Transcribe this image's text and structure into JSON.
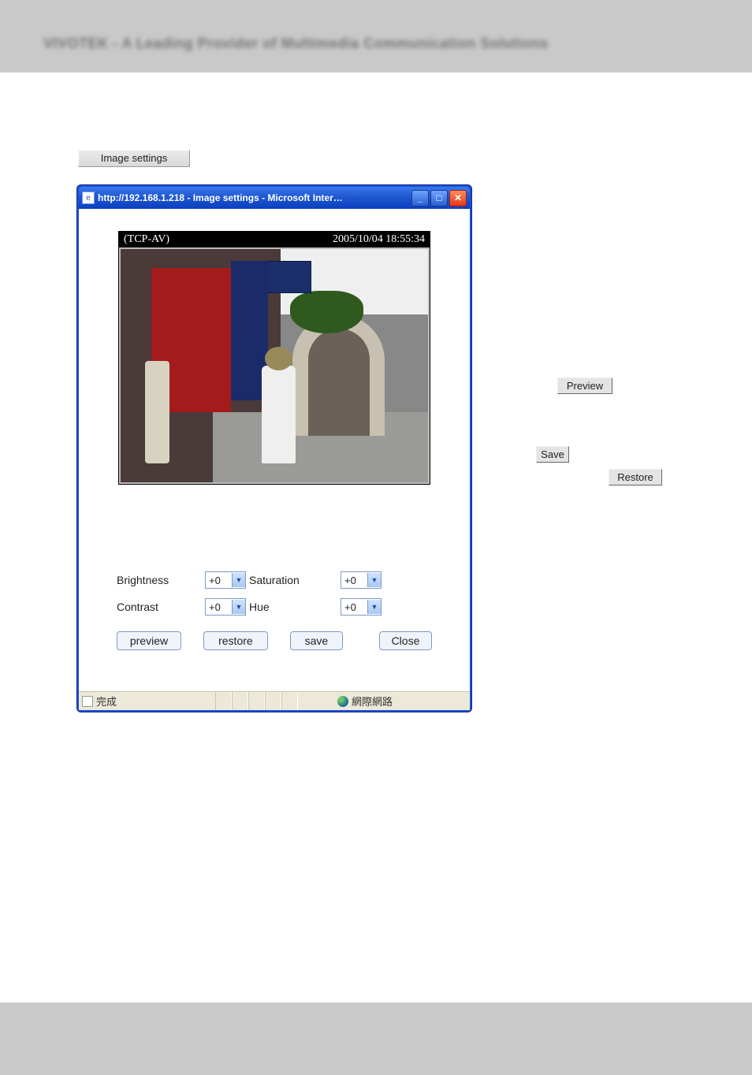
{
  "header": {
    "blurred_text": "VIVOTEK - A Leading Provider of Multimedia Communication Solutions"
  },
  "buttons": {
    "image_settings": "Image settings",
    "preview": "Preview",
    "save": "Save",
    "restore": "Restore"
  },
  "popup": {
    "title": "http://192.168.1.218 - Image settings - Microsoft Inter…",
    "camera_label": "(TCP-AV)",
    "timestamp": "2005/10/04 18:55:34",
    "controls": {
      "brightness_label": "Brightness",
      "brightness_value": "+0",
      "saturation_label": "Saturation",
      "saturation_value": "+0",
      "contrast_label": "Contrast",
      "contrast_value": "+0",
      "hue_label": "Hue",
      "hue_value": "+0"
    },
    "actions": {
      "preview": "preview",
      "restore": "restore",
      "save": "save",
      "close": "Close"
    },
    "status": {
      "left": "完成",
      "right": "網際網路"
    }
  }
}
